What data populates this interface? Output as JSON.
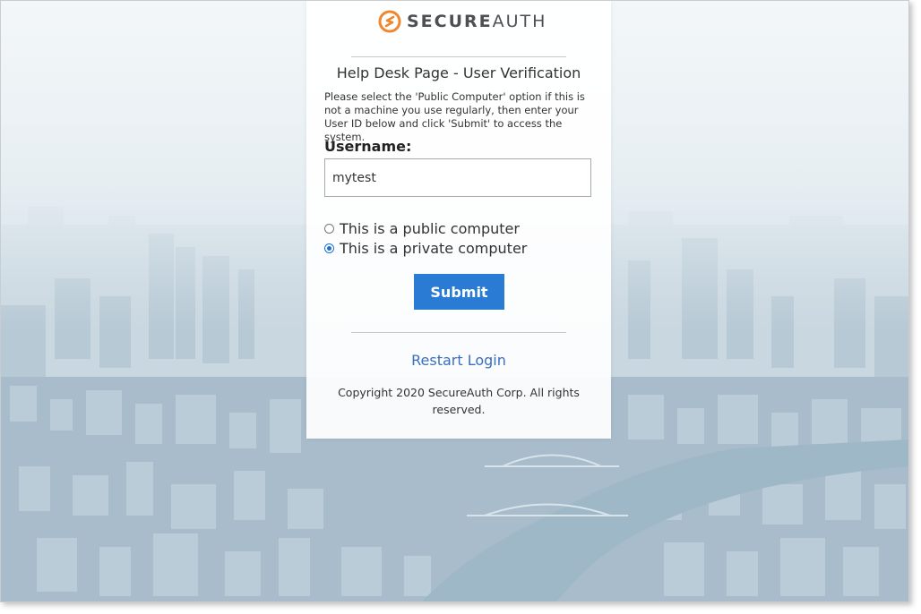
{
  "brand": {
    "logo_bold": "SECURE",
    "logo_light": "AUTH",
    "accent": "#f0862e"
  },
  "page": {
    "title": "Help Desk Page - User Verification",
    "instructions": "Please select the 'Public Computer' option if this is not a machine you use regularly, then enter your User ID below and click 'Submit' to access the system."
  },
  "form": {
    "username_label": "Username:",
    "username_value": "mytest",
    "radio_public_label": "This is a public computer",
    "radio_private_label": "This is a private computer",
    "selected": "private",
    "submit_label": "Submit",
    "submit_color": "#2a7bd3"
  },
  "footer": {
    "restart_label": "Restart Login",
    "copyright": "Copyright 2020 SecureAuth Corp. All rights reserved."
  }
}
